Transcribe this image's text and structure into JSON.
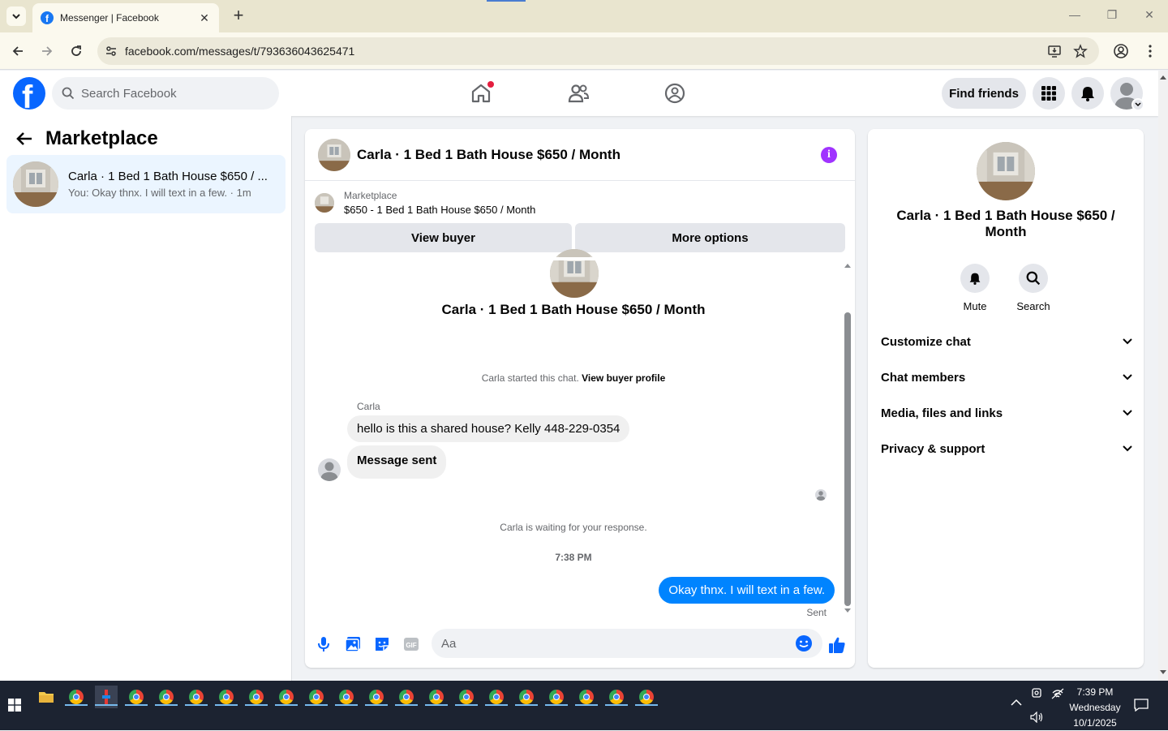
{
  "browser": {
    "tab_title": "Messenger | Facebook",
    "url": "facebook.com/messages/t/793636043625471",
    "minimize": "—",
    "restore": "❐",
    "close": "✕",
    "new_tab": "+"
  },
  "fb_header": {
    "search_placeholder": "Search Facebook",
    "find_friends": "Find friends",
    "home_notification_color": "#e41e3f"
  },
  "sidebar": {
    "title": "Marketplace",
    "conversations": [
      {
        "title": "Carla · 1 Bed 1 Bath House $650 / ...",
        "preview": "You: Okay thnx. I will text in a few. · 1m"
      }
    ]
  },
  "chat": {
    "header_name": "Carla · 1 Bed 1 Bath House $650 / Month",
    "marketplace_label": "Marketplace",
    "marketplace_item": "$650 - 1 Bed 1 Bath House $650 / Month",
    "view_buyer": "View buyer",
    "more_options": "More options",
    "hero_name": "Carla · 1 Bed 1 Bath House $650 / Month",
    "started_text": "Carla started this chat.",
    "view_buyer_profile": "View buyer profile",
    "sender_name": "Carla",
    "messages_in": [
      "hello is this a shared house?  Kelly 448-229-0354",
      "Message sent"
    ],
    "waiting_text": "Carla is waiting for your response.",
    "timestamp": "7:38 PM",
    "message_out": "Okay thnx. I will text in a few.",
    "sent_label": "Sent",
    "composer_placeholder": "Aa"
  },
  "details": {
    "title": "Carla · 1 Bed 1 Bath House $650 / Month",
    "mute": "Mute",
    "search": "Search",
    "sections": [
      "Customize chat",
      "Chat members",
      "Media, files and links",
      "Privacy & support"
    ]
  },
  "taskbar": {
    "time": "7:39 PM",
    "day": "Wednesday",
    "date": "10/1/2025"
  },
  "colors": {
    "fb_blue": "#0866ff",
    "messenger_blue": "#0084ff",
    "info_purple": "#a033ff",
    "selected_conversation": "#ebf5ff"
  }
}
